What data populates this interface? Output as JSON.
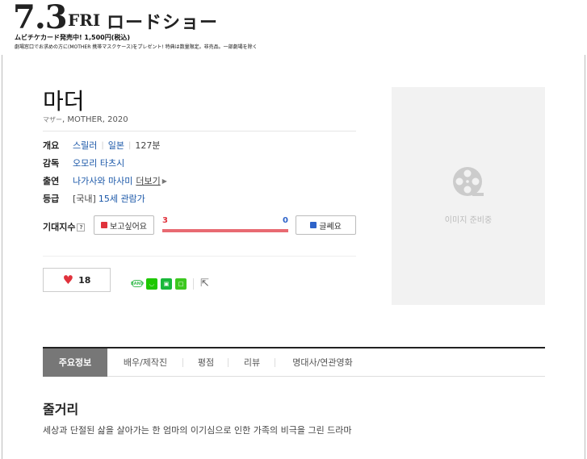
{
  "banner": {
    "date": "7.3",
    "day": "FRI",
    "headline": "ロードショー",
    "line1": "ムビチケカード発売中! 1,500円(税込)",
    "line2": "劇場窓口でお求めの方に(MOTHER 携帯マスクケース)をプレゼント! 特典は数量限定。非売品。一部劇場を除く"
  },
  "movie": {
    "title": "마더",
    "subtitle_jp": "マザー",
    "subtitle_rest": ", MOTHER, 2020"
  },
  "info": {
    "overview_label": "개요",
    "genre": "스릴러",
    "country": "일본",
    "runtime": "127분",
    "director_label": "감독",
    "director": "오모리 타츠시",
    "cast_label": "출연",
    "cast": "나가사와 마사미",
    "more": "더보기",
    "rating_label": "등급",
    "rating_region": "[국내]",
    "rating": "15세 관람가"
  },
  "expectation": {
    "label": "기대지수",
    "help": "?",
    "want_label": "보고싶어요",
    "meh_label": "글쎄요",
    "want_count": "3",
    "meh_count": "0",
    "want_ratio": 1.0
  },
  "like": {
    "count": "18"
  },
  "share": {
    "band": "BAND"
  },
  "poster": {
    "placeholder": "이미지 준비중"
  },
  "tabs": [
    {
      "label": "주요정보"
    },
    {
      "label": "배우/제작진"
    },
    {
      "label": "평점"
    },
    {
      "label": "리뷰"
    },
    {
      "label": "명대사/연관영화"
    }
  ],
  "synopsis": {
    "title": "줄거리",
    "text": "세상과 단절된 삶을 살아가는 한 엄마의 이기심으로 인한 가족의 비극을 그린 드라마"
  },
  "colors": {
    "like_red": "#e0323c",
    "meh_blue": "#2e63c9",
    "link_blue": "#1a57a8",
    "tab_active": "#777777"
  }
}
